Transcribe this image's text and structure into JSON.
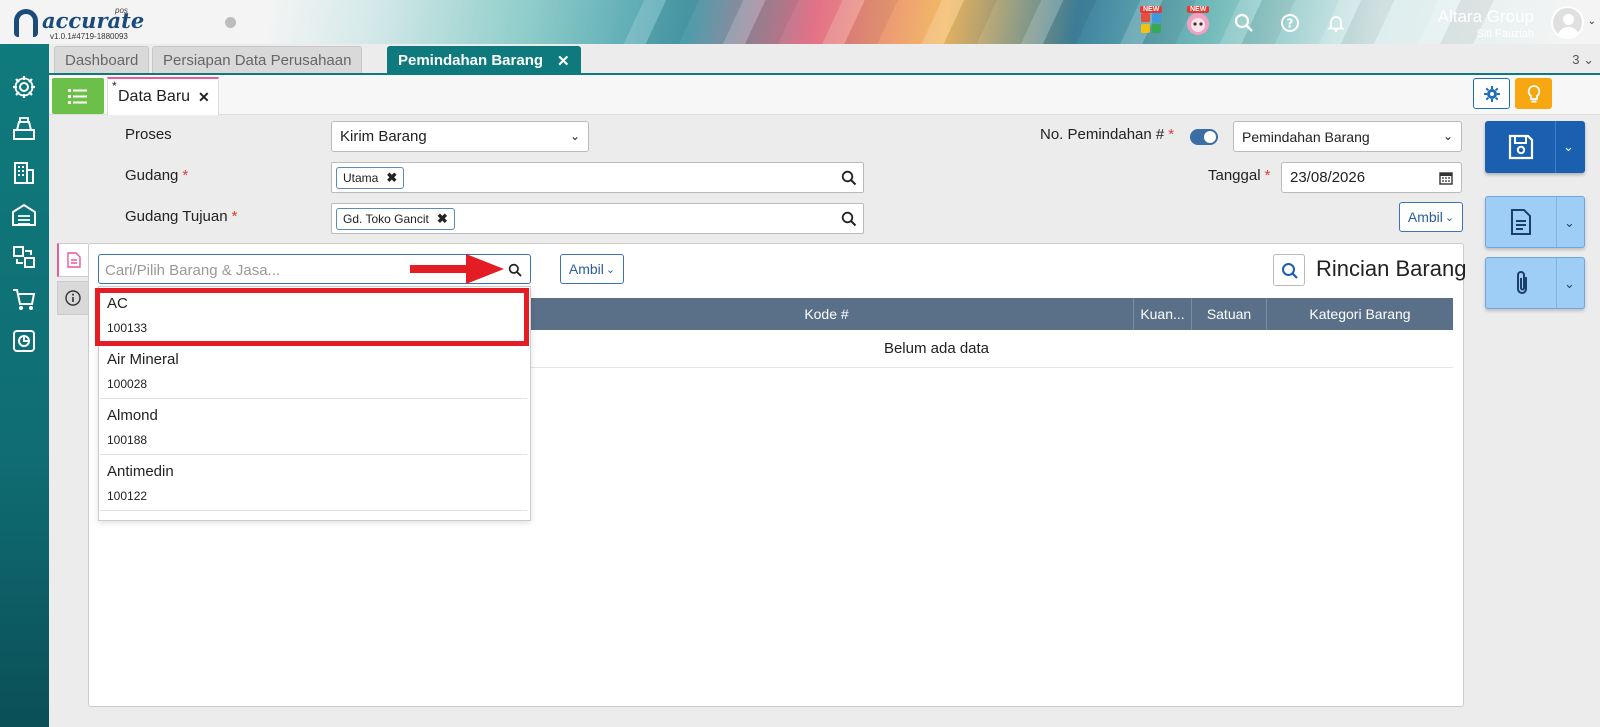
{
  "header": {
    "logo_text": "accurate",
    "logo_pos": "pos",
    "version": "v1.0.1#4719-1880093",
    "badge_new_1": "NEW",
    "badge_new_2": "NEW",
    "org_name": "Altara Group",
    "user_name": "Siti Fauziah"
  },
  "tabs": {
    "items": [
      {
        "label": "Dashboard"
      },
      {
        "label": "Persiapan Data Perusahaan"
      },
      {
        "label": "Pemindahan Barang",
        "active": true
      }
    ],
    "close": "✕",
    "count": "3"
  },
  "subtab": {
    "star": "*",
    "label": "Data Baru",
    "close": "✕"
  },
  "form": {
    "proses_label": "Proses",
    "proses_value": "Kirim Barang",
    "gudang_label": "Gudang",
    "gudang_tag": "Utama",
    "gudang_tujuan_label": "Gudang Tujuan",
    "gudang_tujuan_tag": "Gd. Toko Gancit",
    "no_label": "No. Pemindahan #",
    "no_value": "Pemindahan Barang",
    "tanggal_label": "Tanggal",
    "tanggal_value": "23/08/2026",
    "required_mark": "*",
    "ambil_label": "Ambil"
  },
  "detail": {
    "search_placeholder": "Cari/Pilih Barang & Jasa...",
    "ambil_label": "Ambil",
    "title": "Rincian Barang",
    "columns": [
      "Kode #",
      "Kuan...",
      "Satuan",
      "Kategori Barang"
    ],
    "empty_text": "Belum ada data"
  },
  "dropdown": {
    "items": [
      {
        "name": "AC",
        "code": "100133"
      },
      {
        "name": "Air Mineral",
        "code": "100028"
      },
      {
        "name": "Almond",
        "code": "100188"
      },
      {
        "name": "Antimedin",
        "code": "100122"
      }
    ]
  },
  "colors": {
    "teal": "#0f7a7d",
    "primary_blue": "#1a5fb0",
    "highlight_red": "#e31d23",
    "green": "#6cc04a",
    "orange": "#f7a711"
  }
}
